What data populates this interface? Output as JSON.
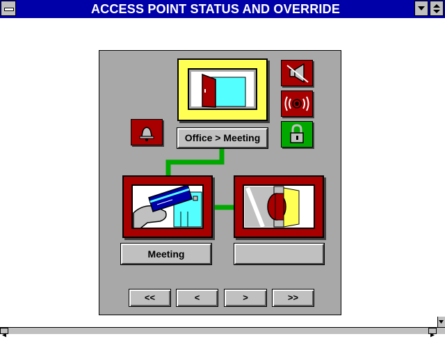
{
  "window": {
    "title": "ACCESS POINT STATUS AND OVERRIDE"
  },
  "icons": {
    "system_menu": "system-menu-icon",
    "minimize": "triangle-down-icon",
    "maximize": "triangle-updown-icon",
    "bell": "bell-icon",
    "siren": "megaphone-icon",
    "alarm": "alarm-icon",
    "lock": "lock-icon"
  },
  "door": {
    "transition_label": "Office > Meeting"
  },
  "reader": {
    "location_label": "Meeting"
  },
  "lock_device": {
    "location_label": ""
  },
  "navigation": {
    "first": "<<",
    "prev": "<",
    "next": ">",
    "last": ">>"
  },
  "colors": {
    "titlebar": "#0000a8",
    "panel": "#a8a8a8",
    "frame_red": "#a80000",
    "frame_yellow": "#ffff54",
    "connector_green": "#00a800",
    "lock_green": "#00a800"
  }
}
